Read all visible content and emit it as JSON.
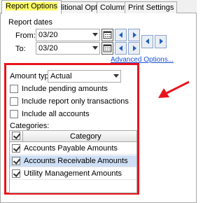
{
  "tabs": [
    {
      "label": "Report Options",
      "active": true
    },
    {
      "label": "Additional Options",
      "active": false
    },
    {
      "label": "Columns",
      "active": false
    },
    {
      "label": "Print Settings",
      "active": false
    }
  ],
  "report_dates": {
    "heading": "Report dates",
    "from_label": "From:",
    "from_value": "03/20",
    "to_label": "To:",
    "to_value": "03/20",
    "advanced_link": "Advanced Options..."
  },
  "amount_type": {
    "label": "Amount type:",
    "value": "Actual"
  },
  "checkboxes": [
    {
      "label": "Include pending amounts",
      "checked": false
    },
    {
      "label": "Include report only transactions",
      "checked": false
    },
    {
      "label": "Include all accounts",
      "checked": false
    }
  ],
  "categories": {
    "label": "Categories:",
    "column_header": "Category",
    "header_checked": true,
    "rows": [
      {
        "label": "Accounts Payable Amounts",
        "checked": true,
        "selected": false
      },
      {
        "label": "Accounts Receivable Amounts",
        "checked": true,
        "selected": true
      },
      {
        "label": "Utility Management Amounts",
        "checked": true,
        "selected": false
      }
    ]
  },
  "colors": {
    "highlight_box": "#e8141c",
    "arrow": "#e8141c",
    "active_tab_highlight": "#ffff66",
    "selected_row": "#cfe0f6"
  },
  "icons": [
    "calendar-icon",
    "previous-icon",
    "next-icon",
    "dropdown-arrow-icon",
    "annotation-arrow"
  ]
}
